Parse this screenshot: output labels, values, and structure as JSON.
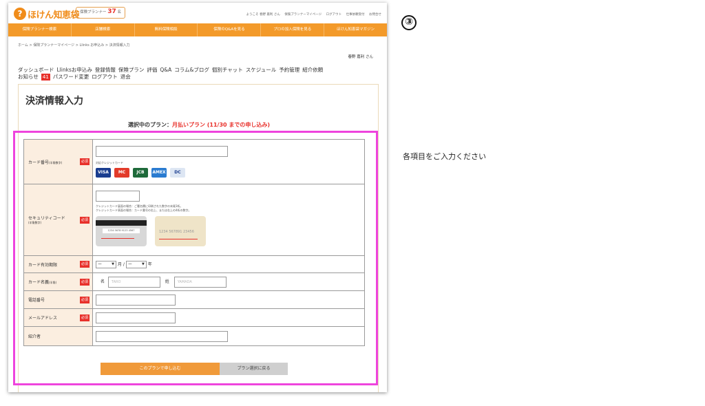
{
  "header": {
    "logo_text": "ほけん知恵袋",
    "count_prefix": "保険プランナー",
    "count_num": "37",
    "count_suffix": "名",
    "toplinks": [
      "ようこそ 春野 嘉利 さん",
      "保険プランナーマイページ",
      "ログアウト",
      "仕事依頼受付",
      "お問合せ"
    ],
    "nav": [
      "保険プランナー検索",
      "店舗検索",
      "無料保険相談",
      "保険のQ&Aを見る",
      "プロの加入保険を見る",
      "ほけん知恵袋マガジン"
    ]
  },
  "breadcrumb": "ホーム > 保険プランナーマイページ > Llinks お申込み > 決済情報入力",
  "username": "春野 嘉利 さん",
  "mypage_nav": {
    "row1": [
      "ダッシュボード",
      "Llinksお申込み",
      "登録情報",
      "保険プラン",
      "評価",
      "Q&A",
      "コラム&ブログ",
      "個別チャット",
      "スケジュール",
      "予約管理",
      "紹介依頼"
    ],
    "notice_label": "お知らせ",
    "notice_count": "41",
    "row2": [
      "パスワード変更",
      "ログアウト",
      "退会"
    ]
  },
  "page_title": "決済情報入力",
  "plan": {
    "prefix": "選択中のプラン：",
    "name": "月払いプラン (11/30 までの申し込み)"
  },
  "form": {
    "required_label": "必須",
    "card_number": {
      "label": "カード番号",
      "note": "(半角数字)",
      "accepted": "対応クレジットカード"
    },
    "cards": [
      "VISA",
      "MC",
      "JCB",
      "AMEX",
      "DC"
    ],
    "security_code": {
      "label": "セキュリティコード",
      "note": "(半角数字)",
      "help1": "クレジットカード裏面の場合：ご署名欄に印刷された数字の末尾3桁。",
      "help2": "クレジットカード表面の場合：カード番号の右上、または右上の4桁の数字。",
      "back_digits": "1234 5678 9123 4567",
      "front_digits": "1234 567891 23456"
    },
    "expiry": {
      "label": "カード有効期限",
      "month_value": "ー",
      "month_unit": "月",
      "sep": "/",
      "year_value": "ー",
      "year_unit": "年"
    },
    "holder": {
      "label": "カード名義",
      "note": "(半角)",
      "first_label": "名",
      "first_placeholder": "TARO",
      "last_label": "姓",
      "last_placeholder": "YAMADA"
    },
    "phone": {
      "label": "電話番号"
    },
    "email": {
      "label": "メールアドレス"
    },
    "referrer": {
      "label": "紹介者"
    }
  },
  "buttons": {
    "apply": "このプランで申し込む",
    "back": "プラン選択に戻る"
  },
  "annotation": {
    "step": "③",
    "text": "各項目をご入力ください"
  },
  "colors": {
    "orange": "#f39a2a",
    "accent_red": "#e8302a",
    "highlight": "#ee44dd"
  }
}
